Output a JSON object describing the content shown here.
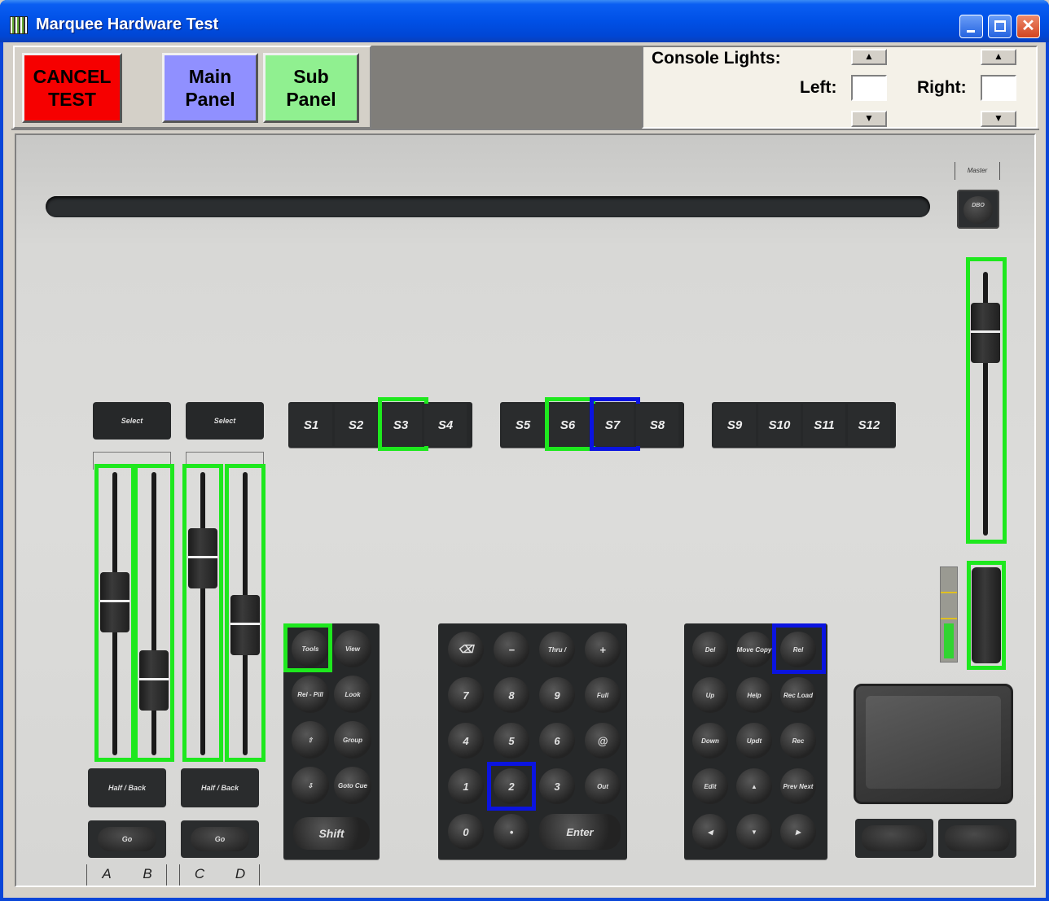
{
  "window": {
    "title": "Marquee Hardware Test",
    "minimize_glyph": "",
    "maximize_glyph": "",
    "close_glyph": "✕"
  },
  "toolbar": {
    "cancel_label": "CANCEL\nTEST",
    "main_panel_label": "Main\nPanel",
    "sub_panel_label": "Sub\nPanel",
    "colors": {
      "cancel": "#f60000",
      "main_panel": "#9090ff",
      "sub_panel": "#90f090"
    }
  },
  "console_lights": {
    "title": "Console Lights:",
    "left_label": "Left:",
    "right_label": "Right:",
    "spin_up_glyph": "▲",
    "spin_down_glyph": "▼",
    "left_value": "",
    "right_value": ""
  },
  "console": {
    "master_label": "Master",
    "master_button_label": "DBO",
    "select_labels": [
      "Select",
      "Select"
    ],
    "sub_buttons": [
      "S1",
      "S2",
      "S3",
      "S4",
      "S5",
      "S6",
      "S7",
      "S8",
      "S9",
      "S10",
      "S11",
      "S12"
    ],
    "highlight_legend": {
      "active_color": "#1ee81e",
      "pressed_color": "#0b14e0"
    },
    "highlighted_green": [
      "S3",
      "S6",
      "Tools",
      "fader-a",
      "fader-b",
      "fader-c",
      "fader-d",
      "master-fader",
      "master-wheel"
    ],
    "highlighted_blue": [
      "S7",
      "2",
      "Rel"
    ],
    "halfback_labels": [
      "Half / Back",
      "Half / Back"
    ],
    "go_labels": [
      "Go",
      "Go"
    ],
    "fader_letters": [
      "A",
      "B",
      "C",
      "D"
    ],
    "fader_levels": {
      "A": 0.55,
      "B": 0.2,
      "C": 0.75,
      "D": 0.45,
      "master": 0.85
    },
    "level_meter": 0.4,
    "tools_keys": [
      "Tools",
      "View",
      "Rel - Pill",
      "Look",
      "⇧",
      "Group",
      "⇩",
      "Goto Cue"
    ],
    "shift_label": "Shift",
    "numpad_keys": [
      "⌫",
      "−",
      "Thru /",
      "+",
      "7",
      "8",
      "9",
      "Full",
      "4",
      "5",
      "6",
      "@",
      "1",
      "2",
      "3",
      "Out"
    ],
    "numpad_bottom": [
      "0",
      "•",
      "Enter"
    ],
    "nav_keys": [
      "Del",
      "Move Copy",
      "Rel",
      "Up",
      "Help",
      "Rec Load",
      "Down",
      "Updt",
      "Rec",
      "Edit",
      "▲",
      "Prev Next",
      "◀",
      "▼",
      "▶"
    ]
  }
}
